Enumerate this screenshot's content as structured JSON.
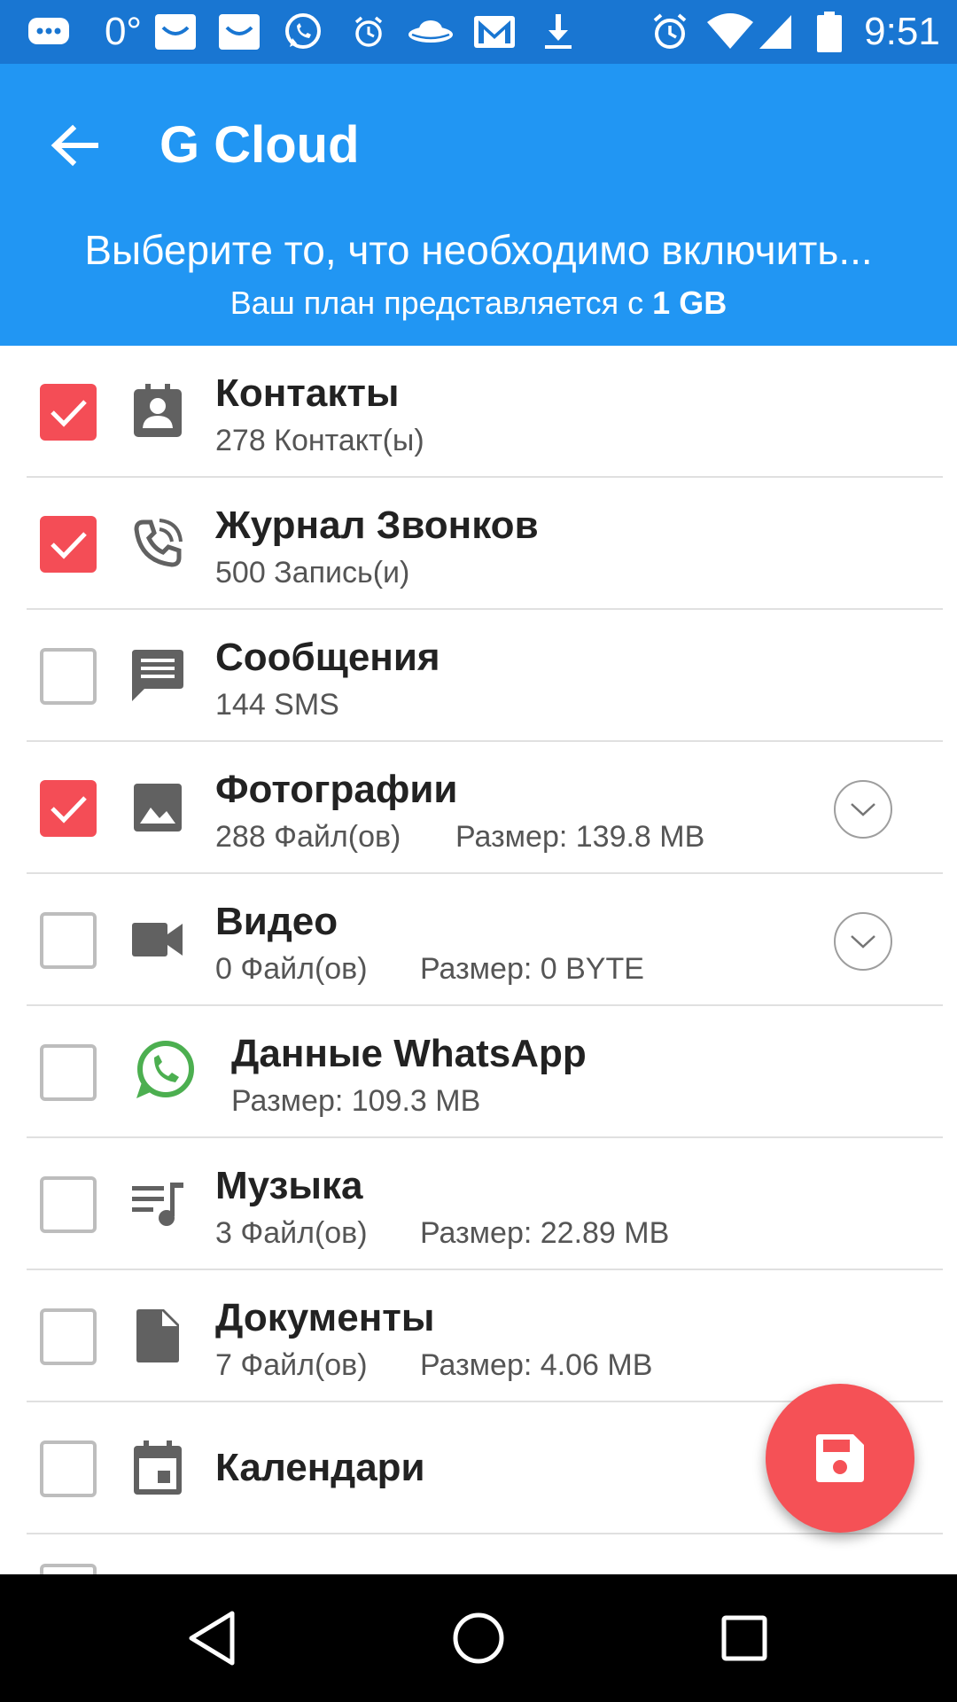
{
  "status_bar": {
    "temperature": "0°",
    "time": "9:51",
    "left_icons": [
      "chat-bubble-icon",
      "temperature-text",
      "mail-app-icon",
      "mail-app-icon",
      "whatsapp-icon",
      "alarm-icon",
      "cloud-saucer-icon",
      "gmail-icon",
      "download-icon"
    ],
    "right_icons": [
      "alarm-icon",
      "wifi-icon",
      "signal-icon",
      "battery-icon"
    ]
  },
  "app_bar": {
    "title": "G Cloud",
    "subtitle": "Выберите то, что необходимо включить...",
    "plan_prefix": "Ваш план представляется с",
    "plan_size": "1 GB",
    "background_color": "#2196F3",
    "status_bar_color": "#1976D2"
  },
  "items": [
    {
      "title": "Контакты",
      "sub": "278 Контакт(ы)",
      "size": "",
      "checked": true,
      "icon": "contacts-icon",
      "expandable": false
    },
    {
      "title": "Журнал Звонков",
      "sub": "500 Запись(и)",
      "size": "",
      "checked": true,
      "icon": "phone-log-icon",
      "expandable": false
    },
    {
      "title": "Сообщения",
      "sub": "144 SMS",
      "size": "",
      "checked": false,
      "icon": "message-icon",
      "expandable": false
    },
    {
      "title": "Фотографии",
      "sub": "288 Файл(ов)",
      "size": "Размер: 139.8 MB",
      "checked": true,
      "icon": "photo-icon",
      "expandable": true
    },
    {
      "title": "Видео",
      "sub": "0 Файл(ов)",
      "size": "Размер: 0 BYTE",
      "checked": false,
      "icon": "video-icon",
      "expandable": true
    },
    {
      "title": "Данные WhatsApp",
      "sub": "Размер: 109.3 MB",
      "size": "",
      "checked": false,
      "icon": "whatsapp-icon",
      "expandable": false
    },
    {
      "title": "Музыка",
      "sub": "3 Файл(ов)",
      "size": "Размер: 22.89 MB",
      "checked": false,
      "icon": "music-icon",
      "expandable": false
    },
    {
      "title": "Документы",
      "sub": "7 Файл(ов)",
      "size": "Размер: 4.06 MB",
      "checked": false,
      "icon": "document-icon",
      "expandable": false
    },
    {
      "title": "Календари",
      "sub": "",
      "size": "",
      "checked": false,
      "icon": "calendar-icon",
      "expandable": false
    }
  ],
  "fab": {
    "icon": "save-icon",
    "color": "#F55156"
  },
  "nav_bar": {
    "buttons": [
      "back-triangle-icon",
      "home-circle-icon",
      "recents-square-icon"
    ]
  },
  "colors": {
    "checked": "#F44D56",
    "unchecked_border": "#BDBDBD",
    "icon_gray": "#616161",
    "whatsapp_green": "#4CAF50"
  }
}
